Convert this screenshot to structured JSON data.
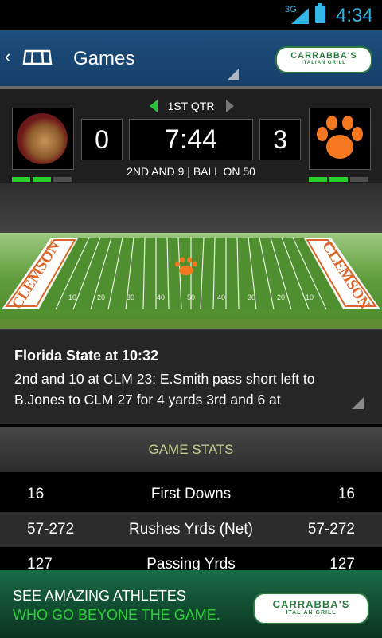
{
  "status_bar": {
    "network": "3G",
    "time": "4:34",
    "accent_color": "#33b5e5"
  },
  "app_bar": {
    "title": "Games",
    "sponsor_line1": "CARRABBA'S",
    "sponsor_line2": "ITALIAN GRILL"
  },
  "scoreboard": {
    "quarter": "1ST QTR",
    "clock": "7:44",
    "home_score": "0",
    "away_score": "3",
    "down_distance": "2ND AND 9 | BALL ON 50",
    "home_timeouts_remaining": 2,
    "away_timeouts_remaining": 2,
    "timeout_color": "#29d02c"
  },
  "field": {
    "endzone_left_text": "CLEMSON",
    "endzone_right_text": "CLEMSON",
    "yard_numbers": [
      "10",
      "20",
      "30",
      "40",
      "50",
      "40",
      "30",
      "20",
      "10"
    ]
  },
  "play": {
    "title": "Florida State at 10:32",
    "text": "2nd and 10 at CLM 23: E.Smith pass short left to B.Jones to CLM 27 for 4 yards 3rd and 6 at"
  },
  "stats": {
    "header": "GAME STATS",
    "rows": [
      {
        "left": "16",
        "label": "First Downs",
        "right": "16"
      },
      {
        "left": "57-272",
        "label": "Rushes Yrds (Net)",
        "right": "57-272"
      },
      {
        "left": "127",
        "label": "Passing Yrds",
        "right": "127"
      }
    ]
  },
  "ad": {
    "line1": "SEE AMAZING ATHLETES",
    "line2": "WHO GO BEYONE THE GAME.",
    "logo_line1": "CARRABBA'S",
    "logo_line2": "ITALIAN GRILL"
  }
}
